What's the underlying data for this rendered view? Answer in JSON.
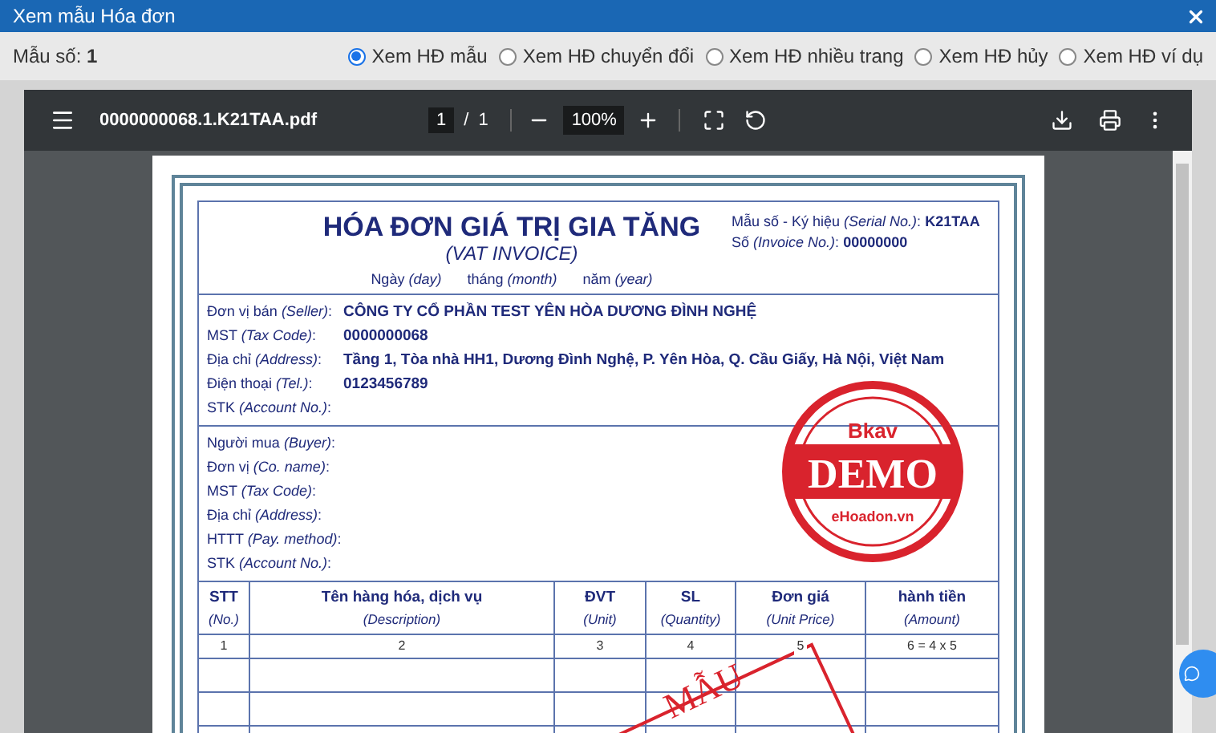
{
  "window": {
    "title": "Xem mẫu Hóa đơn"
  },
  "form_number": {
    "label": "Mẫu số:",
    "value": "1"
  },
  "view_options": [
    {
      "label": "Xem HĐ mẫu",
      "selected": true
    },
    {
      "label": "Xem HĐ chuyển đổi",
      "selected": false
    },
    {
      "label": "Xem HĐ nhiều trang",
      "selected": false
    },
    {
      "label": "Xem HĐ hủy",
      "selected": false
    },
    {
      "label": "Xem HĐ ví dụ",
      "selected": false
    }
  ],
  "pdf_viewer": {
    "file_name": "0000000068.1.K21TAA.pdf",
    "page": "1",
    "page_separator": "/",
    "page_total": "1",
    "zoom": "100%"
  },
  "invoice": {
    "title": "HÓA ĐƠN GIÁ TRỊ GIA TĂNG",
    "subtitle": "(VAT INVOICE)",
    "date_parts": [
      "Ngày *(day)*",
      "tháng *(month)*",
      "năm *(year)*"
    ],
    "serial": {
      "label": "Mẫu số - Ký hiệu *(Serial No.)*:",
      "value": "K21TAA"
    },
    "number": {
      "label": "Số *(Invoice No.)*:",
      "value": "00000000"
    },
    "seller": [
      {
        "label": "Đơn vị bán *(Seller)*:",
        "value": "CÔNG TY CỔ PHẦN TEST YÊN HÒA DƯƠNG ĐÌNH NGHỆ"
      },
      {
        "label": "MST *(Tax Code)*:",
        "value": "0000000068"
      },
      {
        "label": "Địa chỉ *(Address)*:",
        "value": "Tầng 1, Tòa nhà HH1, Dương Đình Nghệ, P. Yên Hòa, Q. Cầu Giấy, Hà Nội, Việt Nam"
      },
      {
        "label": "Điện thoại *(Tel.)*:",
        "value": "0123456789"
      },
      {
        "label": "STK *(Account No.)*:"
      }
    ],
    "buyer": [
      "Người mua *(Buyer)*:",
      "Đơn vị *(Co. name)*:",
      "MST *(Tax Code)*:",
      "Địa chỉ *(Address)*:",
      "HTTT *(Pay. method)*:",
      "STK *(Account No.)*:"
    ],
    "columns": [
      {
        "title": "STT",
        "en": "(No.)",
        "index": "1"
      },
      {
        "title": "Tên hàng hóa, dịch vụ",
        "en": "(Description)",
        "index": "2"
      },
      {
        "title": "ĐVT",
        "en": "(Unit)",
        "index": "3"
      },
      {
        "title": "SL",
        "en": "(Quantity)",
        "index": "4"
      },
      {
        "title": "Đơn giá",
        "en": "(Unit Price)",
        "index": "5"
      },
      {
        "title": "hành tiền",
        "en": "(Amount)",
        "index": "6 = 4 x 5"
      }
    ],
    "stamps": [
      {
        "kind": "round",
        "texts": [
          "Bkav",
          "DEMO",
          "eHoadon.vn"
        ]
      },
      {
        "kind": "rect",
        "texts": [
          "MẪU"
        ]
      }
    ]
  }
}
